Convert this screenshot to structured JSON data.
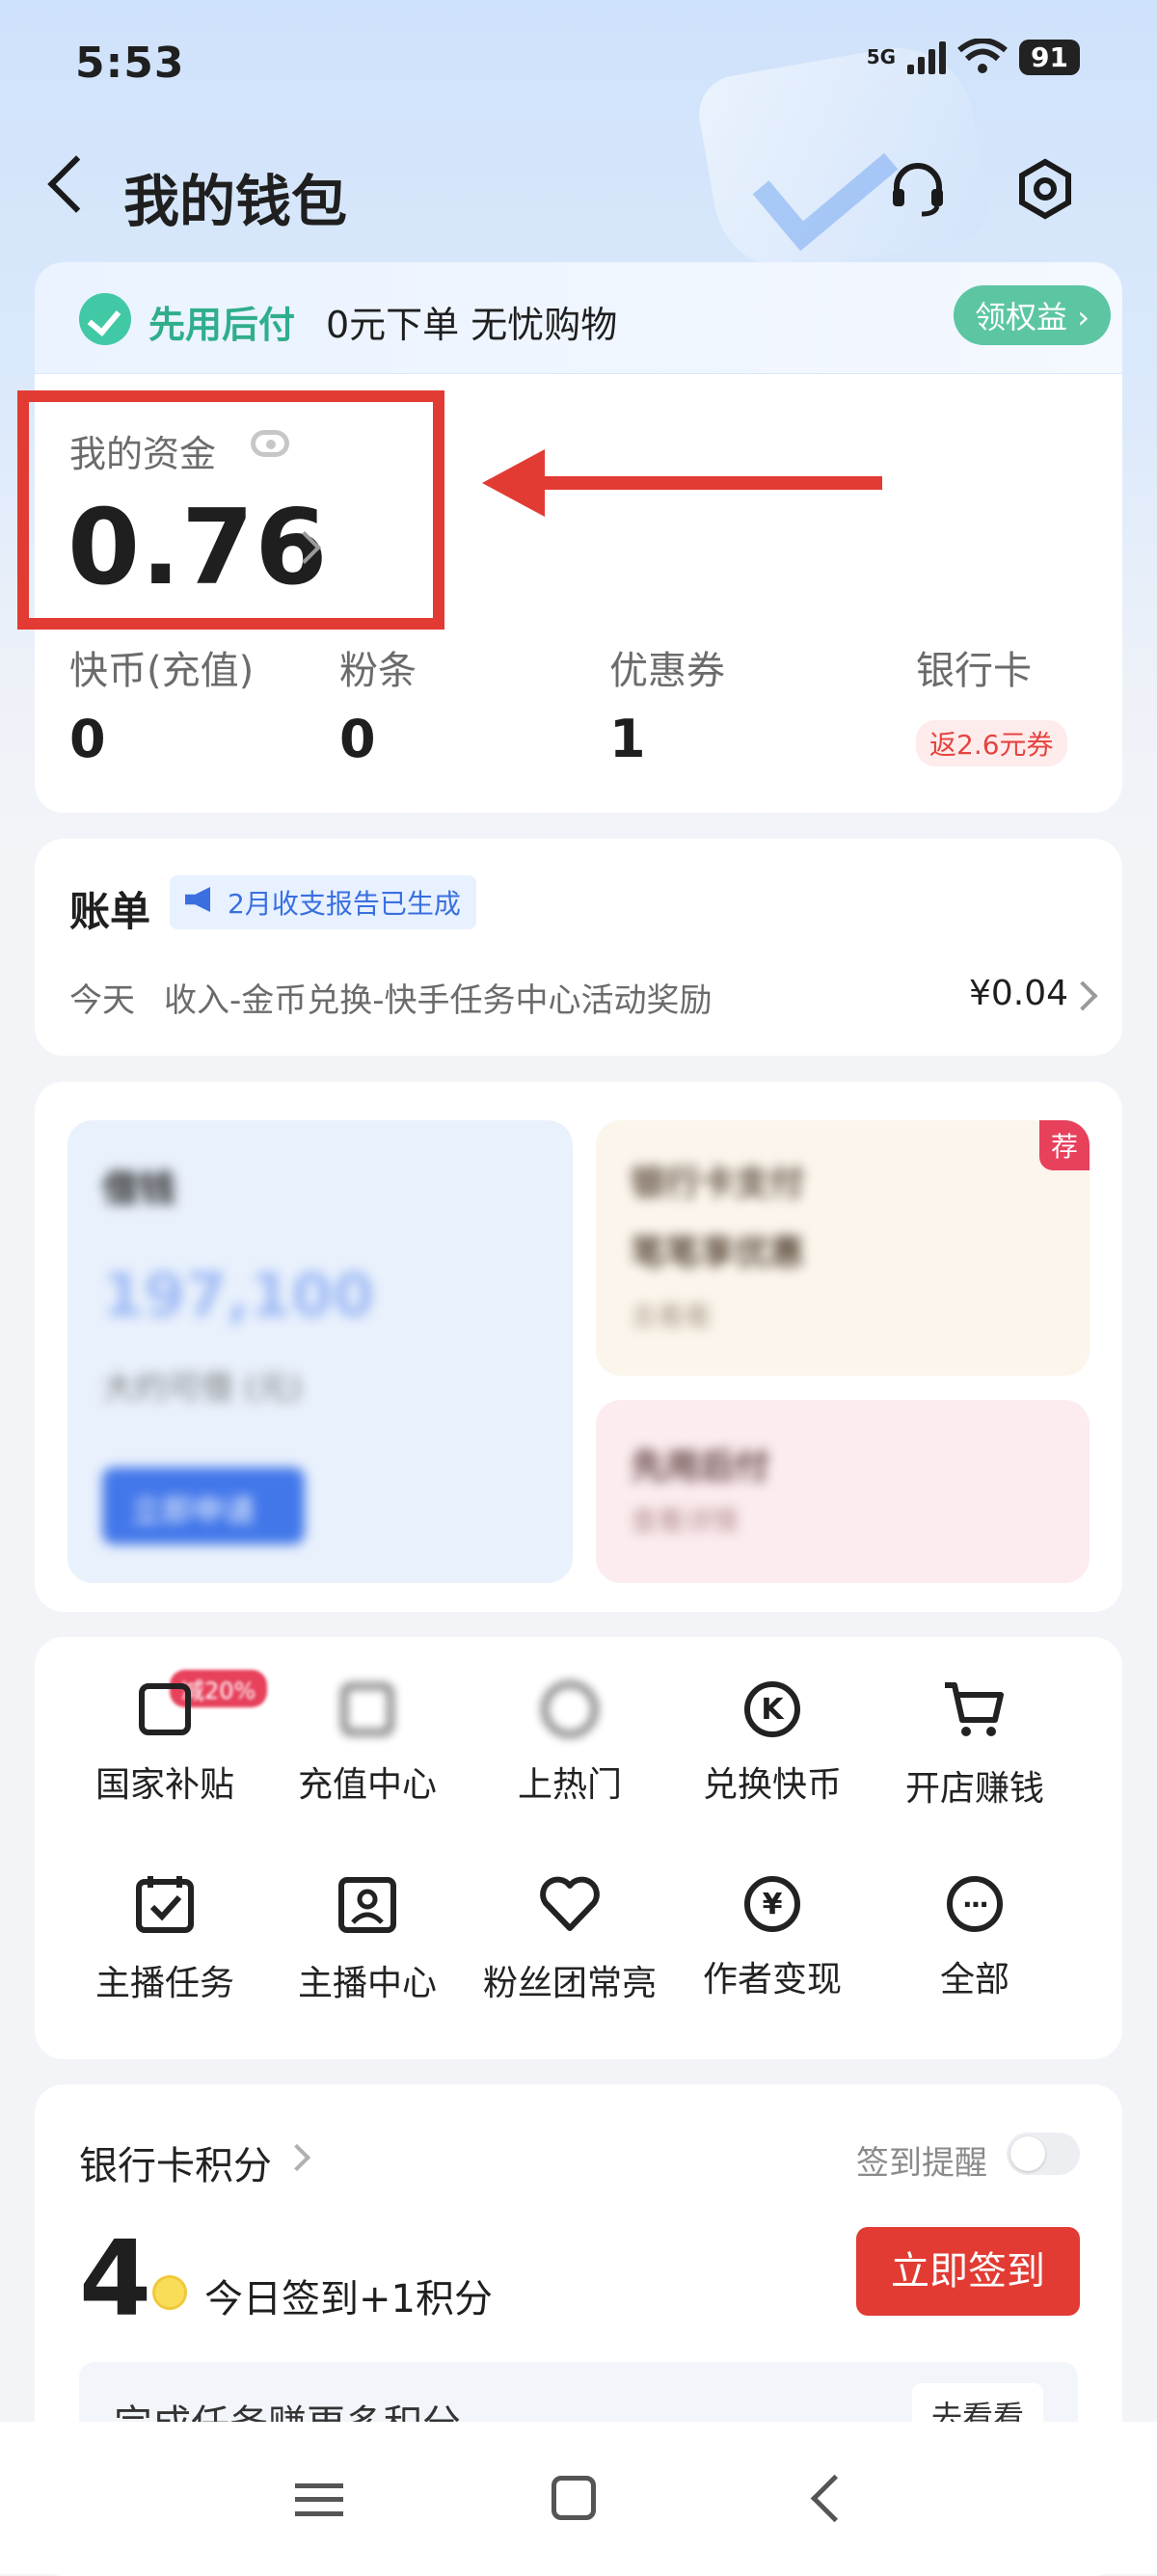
{
  "status_bar": {
    "time": "5:53",
    "network": "5G",
    "battery": "91"
  },
  "nav": {
    "title": "我的钱包",
    "icons": [
      "back-icon",
      "headset-icon",
      "settings-icon"
    ]
  },
  "promo": {
    "title": "先用后付",
    "subtitle": "0元下单 无忧购物",
    "button": "领权益"
  },
  "funds": {
    "label": "我的资金",
    "amount": "0.76",
    "assets": [
      {
        "label": "快币(充值)",
        "value": "0"
      },
      {
        "label": "粉条",
        "value": "0"
      },
      {
        "label": "优惠券",
        "value": "1"
      },
      {
        "label": "银行卡",
        "tag": "返2.6元券"
      }
    ]
  },
  "bill": {
    "title": "账单",
    "tag": "2月收支报告已生成",
    "row": {
      "date": "今天",
      "desc": "收入-金币兑换-快手任务中心活动奖励",
      "amount": "¥0.04"
    }
  },
  "promo_area": {
    "loan": {
      "title": "借钱",
      "amount": "197,100",
      "subtitle": "大约可借 (元)",
      "button": "立即申请"
    },
    "bank_card": {
      "line1": "银行卡支付",
      "line2": "笔笔享优惠",
      "line3": "去看看",
      "badge": "荐"
    },
    "pay_later": {
      "line1": "先用后付",
      "line2": "查看详情"
    }
  },
  "services": {
    "reduce_tag": "减20%",
    "items": [
      {
        "label": "国家补贴",
        "icon": "subsidy-icon"
      },
      {
        "label": "充值中心",
        "icon": "recharge-icon"
      },
      {
        "label": "上热门",
        "icon": "hot-icon"
      },
      {
        "label": "兑换快币",
        "icon": "exchange-coin-icon"
      },
      {
        "label": "开店赚钱",
        "icon": "cart-icon"
      },
      {
        "label": "主播任务",
        "icon": "calendar-check-icon"
      },
      {
        "label": "主播中心",
        "icon": "anchor-center-icon"
      },
      {
        "label": "粉丝团常亮",
        "icon": "heart-icon"
      },
      {
        "label": "作者变现",
        "icon": "yuan-icon"
      },
      {
        "label": "全部",
        "icon": "more-icon"
      }
    ]
  },
  "points": {
    "title": "银行卡积分",
    "remind_label": "签到提醒",
    "value": "4",
    "text": "今日签到+1积分",
    "button": "立即签到",
    "task_text": "完成任务赚更多积分",
    "task_button": "去看看"
  },
  "colors": {
    "accent_red": "#e23b33",
    "accent_green": "#41c9a5",
    "blue": "#3a6fe0"
  }
}
